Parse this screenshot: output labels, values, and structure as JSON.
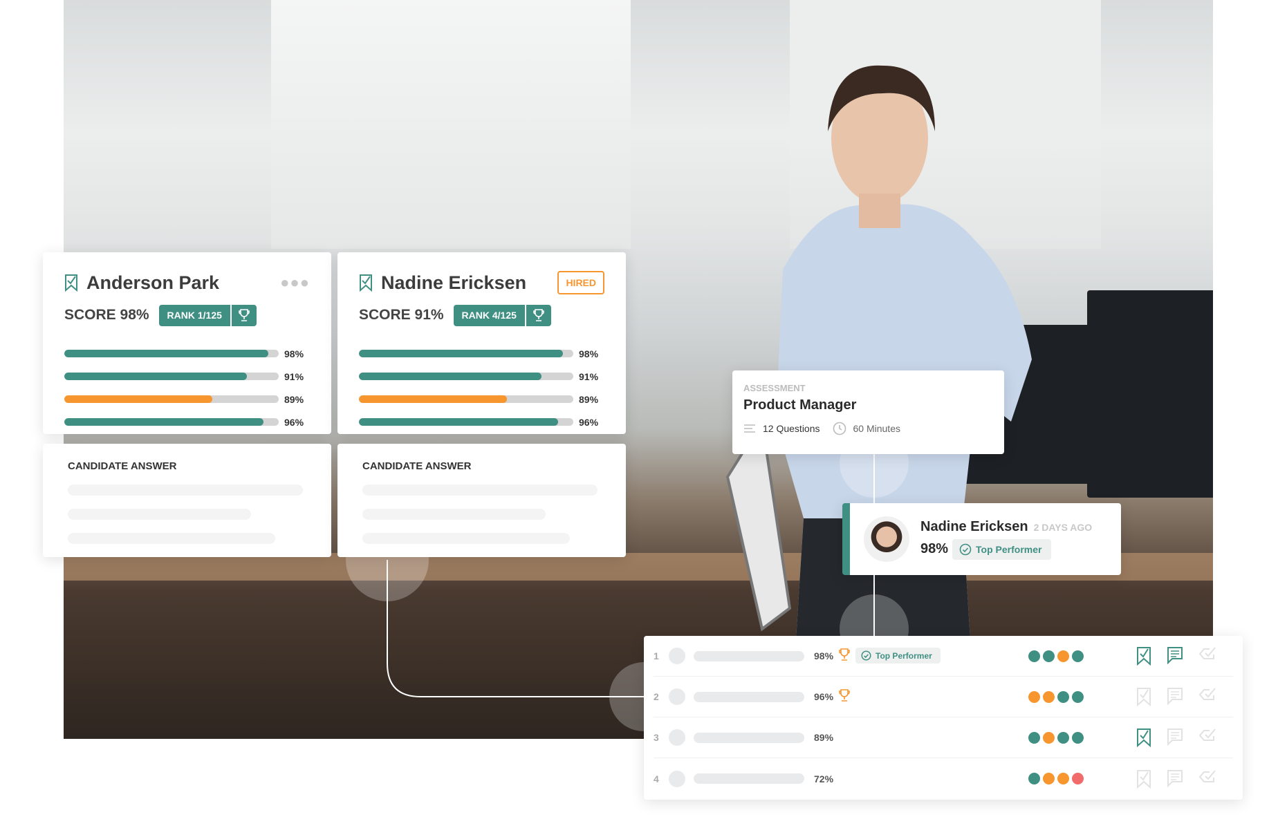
{
  "colors": {
    "teal": "#3f8f83",
    "orange": "#f7952f",
    "red": "#f26b6b",
    "track": "#d4d4d4"
  },
  "candidates": [
    {
      "name": "Anderson Park",
      "score": "SCORE 98%",
      "rank": "RANK 1/125",
      "menu_icon": "more-dots-icon",
      "bars": [
        {
          "label": "98%",
          "fill": 0.95,
          "color": "teal"
        },
        {
          "label": "91%",
          "fill": 0.85,
          "color": "teal"
        },
        {
          "label": "89%",
          "fill": 0.69,
          "color": "orange"
        },
        {
          "label": "96%",
          "fill": 0.93,
          "color": "teal"
        }
      ],
      "answer_label": "CANDIDATE ANSWER"
    },
    {
      "name": "Nadine Ericksen",
      "score": "SCORE 91%",
      "rank": "RANK 4/125",
      "badge": "HIRED",
      "bars": [
        {
          "label": "98%",
          "fill": 0.95,
          "color": "teal"
        },
        {
          "label": "91%",
          "fill": 0.85,
          "color": "teal"
        },
        {
          "label": "89%",
          "fill": 0.69,
          "color": "orange"
        },
        {
          "label": "96%",
          "fill": 0.93,
          "color": "teal"
        }
      ],
      "answer_label": "CANDIDATE ANSWER"
    }
  ],
  "assessment": {
    "kicker": "ASSESSMENT",
    "title": "Product Manager",
    "questions": "12 Questions",
    "duration": "60 Minutes"
  },
  "notification": {
    "name": "Nadine Ericksen",
    "time": "2 DAYS AGO",
    "score": "98%",
    "tag": "Top Performer"
  },
  "results": [
    {
      "rank": "1",
      "score": "98%",
      "trophy": true,
      "tag": "Top Performer",
      "dots": [
        "teal",
        "teal",
        "orange",
        "teal"
      ],
      "shortlisted": true,
      "commented": true,
      "checked": false
    },
    {
      "rank": "2",
      "score": "96%",
      "trophy": true,
      "dots": [
        "orange",
        "orange",
        "teal",
        "teal"
      ],
      "shortlisted": false,
      "commented": false,
      "checked": false
    },
    {
      "rank": "3",
      "score": "89%",
      "trophy": false,
      "dots": [
        "teal",
        "orange",
        "teal",
        "teal"
      ],
      "shortlisted": true,
      "commented": false,
      "checked": false
    },
    {
      "rank": "4",
      "score": "72%",
      "trophy": false,
      "dots": [
        "teal",
        "orange",
        "orange",
        "red"
      ],
      "shortlisted": false,
      "commented": false,
      "checked": false
    }
  ]
}
